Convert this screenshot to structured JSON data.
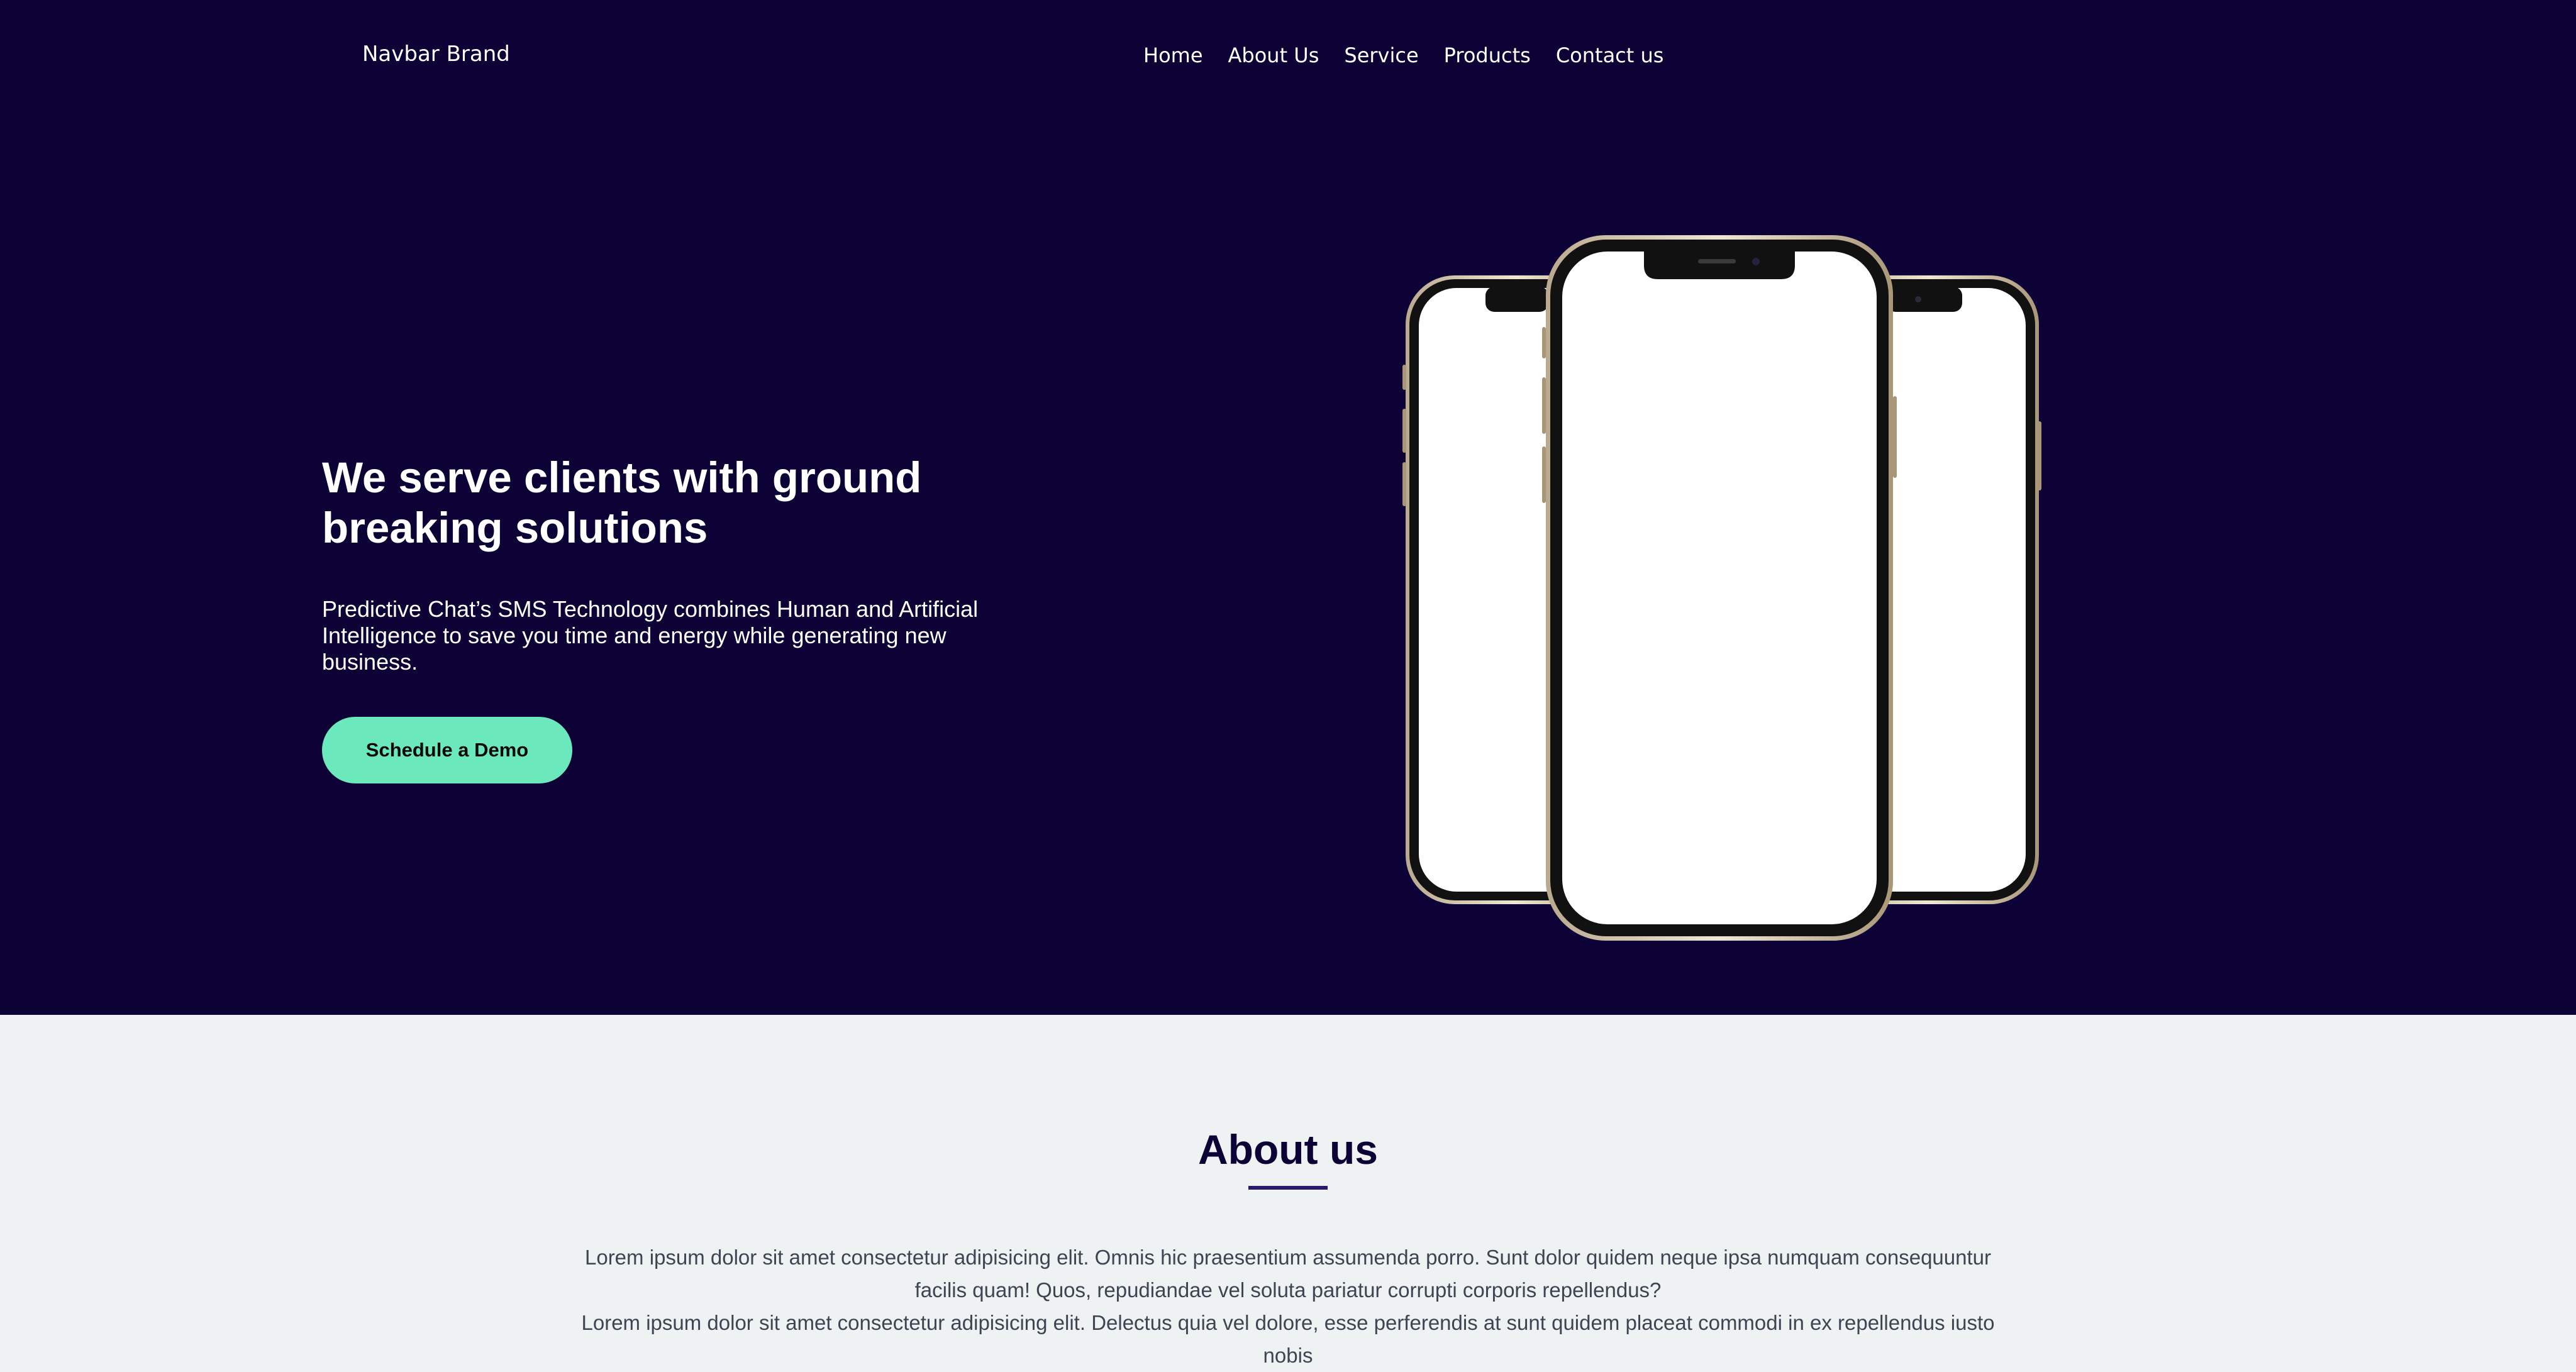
{
  "navbar": {
    "brand": "Navbar Brand",
    "links": [
      {
        "label": "Home"
      },
      {
        "label": "About Us"
      },
      {
        "label": "Service"
      },
      {
        "label": "Products"
      },
      {
        "label": "Contact us"
      }
    ]
  },
  "hero": {
    "title": "We serve clients with ground breaking solutions",
    "description": "Predictive Chat’s SMS Technology combines Human and Artificial Intelligence to save you time and energy while generating new business.",
    "cta_label": "Schedule a Demo",
    "image": "three-smartphones-mockup"
  },
  "about": {
    "title": "About us",
    "paragraphs": [
      "Lorem ipsum dolor sit amet consectetur adipisicing elit. Omnis hic praesentium assumenda porro. Sunt dolor quidem neque ipsa numquam consequuntur facilis quam! Quos, repudiandae vel soluta pariatur corrupti corporis repellendus?",
      "Lorem ipsum dolor sit amet consectetur adipisicing elit. Delectus quia vel dolore, esse perferendis at sunt quidem placeat commodi in ex repellendus iusto nobis"
    ]
  },
  "colors": {
    "hero_background": "#0d0235",
    "cta_background": "#6ce9bc",
    "about_background": "#eff2f3",
    "heading_dark": "#0d0235",
    "underline": "#2a1a6e",
    "body_text": "#3d4452"
  }
}
